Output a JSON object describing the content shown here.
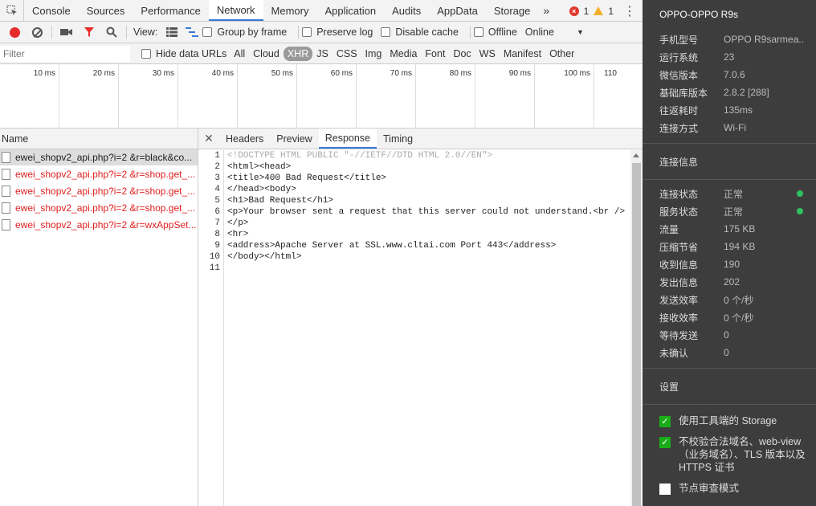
{
  "devtools": {
    "tabs": [
      "Console",
      "Sources",
      "Performance",
      "Network",
      "Memory",
      "Application",
      "Audits",
      "AppData",
      "Storage"
    ],
    "active_tab": "Network",
    "more": "»",
    "error_count": "1",
    "warning_count": "1",
    "kebab": "⋮"
  },
  "toolbar": {
    "view_label": "View:",
    "group_by_frame": "Group by frame",
    "preserve_log": "Preserve log",
    "disable_cache": "Disable cache",
    "offline": "Offline",
    "throttle": "Online",
    "throttle_arrow": "▼"
  },
  "filter": {
    "placeholder": "Filter",
    "hide_data_urls": "Hide data URLs",
    "types": [
      "All",
      "Cloud",
      "XHR",
      "JS",
      "CSS",
      "Img",
      "Media",
      "Font",
      "Doc",
      "WS",
      "Manifest",
      "Other"
    ],
    "selected_type": "XHR"
  },
  "timeline": {
    "ticks": [
      "10 ms",
      "20 ms",
      "30 ms",
      "40 ms",
      "50 ms",
      "60 ms",
      "70 ms",
      "80 ms",
      "90 ms",
      "100 ms",
      "110"
    ]
  },
  "requests": {
    "header": "Name",
    "items": [
      {
        "name": "ewei_shopv2_api.php?i=2 &r=black&co...",
        "state": "selected"
      },
      {
        "name": "ewei_shopv2_api.php?i=2 &r=shop.get_...",
        "state": "error"
      },
      {
        "name": "ewei_shopv2_api.php?i=2 &r=shop.get_...",
        "state": "error"
      },
      {
        "name": "ewei_shopv2_api.php?i=2 &r=shop.get_...",
        "state": "error"
      },
      {
        "name": "ewei_shopv2_api.php?i=2 &r=wxAppSet...",
        "state": "error"
      }
    ]
  },
  "detail": {
    "close": "✕",
    "tabs": [
      "Headers",
      "Preview",
      "Response",
      "Timing"
    ],
    "active_tab": "Response",
    "line_numbers": [
      "1",
      "2",
      "3",
      "4",
      "5",
      "6",
      "7",
      "8",
      "9",
      "10",
      "11"
    ],
    "lines": [
      "<!DOCTYPE HTML PUBLIC \"-//IETF//DTD HTML 2.0//EN\">",
      "<html><head>",
      "<title>400 Bad Request</title>",
      "</head><body>",
      "<h1>Bad Request</h1>",
      "<p>Your browser sent a request that this server could not understand.<br />",
      "</p>",
      "<hr>",
      "<address>Apache Server at SSL.www.cltai.com Port 443</address>",
      "</body></html>",
      ""
    ]
  },
  "panel": {
    "title": "OPPO-OPPO R9s",
    "device": [
      {
        "k": "手机型号",
        "v": "OPPO R9sarmea..."
      },
      {
        "k": "运行系统",
        "v": "23"
      },
      {
        "k": "微信版本",
        "v": "7.0.6"
      },
      {
        "k": "基础库版本",
        "v": "2.8.2 [288]"
      },
      {
        "k": "往返耗时",
        "v": "135ms"
      },
      {
        "k": "连接方式",
        "v": "Wi-Fi"
      }
    ],
    "conn_heading": "连接信息",
    "conn": [
      {
        "k": "连接状态",
        "v": "正常",
        "dot": true
      },
      {
        "k": "服务状态",
        "v": "正常",
        "dot": true
      },
      {
        "k": "流量",
        "v": "175 KB"
      },
      {
        "k": "压缩节省",
        "v": "194 KB"
      },
      {
        "k": "收到信息",
        "v": "190"
      },
      {
        "k": "发出信息",
        "v": "202"
      },
      {
        "k": "发送效率",
        "v": "0 个/秒"
      },
      {
        "k": "接收效率",
        "v": "0 个/秒"
      },
      {
        "k": "等待发送",
        "v": "0"
      },
      {
        "k": "未确认",
        "v": "0"
      }
    ],
    "settings_heading": "设置",
    "options": [
      {
        "label": "使用工具端的 Storage",
        "checked": true
      },
      {
        "label": "不校验合法域名、web-view（业务域名）、TLS 版本以及 HTTPS 证书",
        "checked": true
      },
      {
        "label": "节点审查模式",
        "checked": false
      }
    ],
    "colors": {
      "ok_dot": "#2fc15e",
      "check_on": "#1aad19"
    }
  }
}
